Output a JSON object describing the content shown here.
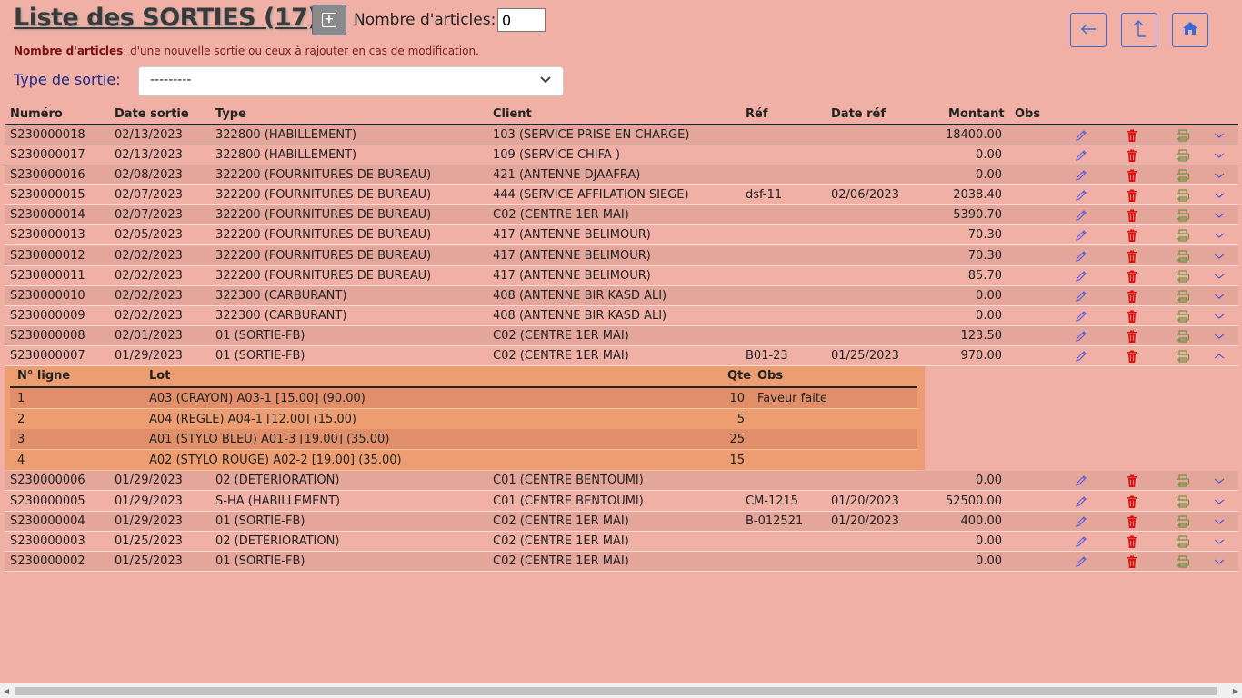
{
  "header": {
    "title": "Liste des SORTIES (17)",
    "add_icon_glyph": "+",
    "nb_articles_label": "Nombre d'articles:",
    "nb_articles_value": "0",
    "help_bold": "Nombre d'articles",
    "help_text": ": d'une nouvelle sortie ou ceux à rajouter en cas de modification.",
    "type_label": "Type de sortie:",
    "type_selected": "---------"
  },
  "nav": {
    "back_icon": "arrow-left-icon",
    "up_icon": "arrow-up-icon",
    "home_icon": "home-icon",
    "accent_color": "#3a6bd8"
  },
  "table": {
    "columns": {
      "numero": "Numéro",
      "date_sortie": "Date sortie",
      "type": "Type",
      "client": "Client",
      "ref": "Réf",
      "date_ref": "Date réf",
      "montant": "Montant",
      "obs": "Obs"
    },
    "rows": [
      {
        "numero": "S230000018",
        "date": "02/13/2023",
        "type": "322800 (HABILLEMENT)",
        "client": "103 (SERVICE PRISE EN CHARGE)",
        "ref": "",
        "date_ref": "",
        "montant": "18400.00"
      },
      {
        "numero": "S230000017",
        "date": "02/13/2023",
        "type": "322800 (HABILLEMENT)",
        "client": "109 (SERVICE CHIFA )",
        "ref": "",
        "date_ref": "",
        "montant": "0.00"
      },
      {
        "numero": "S230000016",
        "date": "02/08/2023",
        "type": "322200 (FOURNITURES DE BUREAU)",
        "client": "421 (ANTENNE DJAAFRA)",
        "ref": "",
        "date_ref": "",
        "montant": "0.00"
      },
      {
        "numero": "S230000015",
        "date": "02/07/2023",
        "type": "322200 (FOURNITURES DE BUREAU)",
        "client": "444 (SERVICE AFFILATION SIEGE)",
        "ref": "dsf-11",
        "date_ref": "02/06/2023",
        "montant": "2038.40"
      },
      {
        "numero": "S230000014",
        "date": "02/07/2023",
        "type": "322200 (FOURNITURES DE BUREAU)",
        "client": "C02 (CENTRE 1ER MAI)",
        "ref": "",
        "date_ref": "",
        "montant": "5390.70"
      },
      {
        "numero": "S230000013",
        "date": "02/05/2023",
        "type": "322200 (FOURNITURES DE BUREAU)",
        "client": "417 (ANTENNE BELIMOUR)",
        "ref": "",
        "date_ref": "",
        "montant": "70.30"
      },
      {
        "numero": "S230000012",
        "date": "02/02/2023",
        "type": "322200 (FOURNITURES DE BUREAU)",
        "client": "417 (ANTENNE BELIMOUR)",
        "ref": "",
        "date_ref": "",
        "montant": "70.30"
      },
      {
        "numero": "S230000011",
        "date": "02/02/2023",
        "type": "322200 (FOURNITURES DE BUREAU)",
        "client": "417 (ANTENNE BELIMOUR)",
        "ref": "",
        "date_ref": "",
        "montant": "85.70"
      },
      {
        "numero": "S230000010",
        "date": "02/02/2023",
        "type": "322300 (CARBURANT)",
        "client": "408 (ANTENNE BIR KASD ALI)",
        "ref": "",
        "date_ref": "",
        "montant": "0.00"
      },
      {
        "numero": "S230000009",
        "date": "02/02/2023",
        "type": "322300 (CARBURANT)",
        "client": "408 (ANTENNE BIR KASD ALI)",
        "ref": "",
        "date_ref": "",
        "montant": "0.00"
      },
      {
        "numero": "S230000008",
        "date": "02/01/2023",
        "type": "01 (SORTIE-FB)",
        "client": "C02 (CENTRE 1ER MAI)",
        "ref": "",
        "date_ref": "",
        "montant": "123.50"
      },
      {
        "numero": "S230000007",
        "date": "01/29/2023",
        "type": "01 (SORTIE-FB)",
        "client": "C02 (CENTRE 1ER MAI)",
        "ref": "B01-23",
        "date_ref": "01/25/2023",
        "montant": "970.00"
      },
      {
        "numero": "S230000006",
        "date": "01/29/2023",
        "type": "02 (DETERIORATION)",
        "client": "C01 (CENTRE BENTOUMI)",
        "ref": "",
        "date_ref": "",
        "montant": "0.00"
      },
      {
        "numero": "S230000005",
        "date": "01/29/2023",
        "type": "S-HA (HABILLEMENT)",
        "client": "C01 (CENTRE BENTOUMI)",
        "ref": "CM-1215",
        "date_ref": "01/20/2023",
        "montant": "52500.00"
      },
      {
        "numero": "S230000004",
        "date": "01/29/2023",
        "type": "01 (SORTIE-FB)",
        "client": "C02 (CENTRE 1ER MAI)",
        "ref": "B-012521",
        "date_ref": "01/20/2023",
        "montant": "400.00"
      },
      {
        "numero": "S230000003",
        "date": "01/25/2023",
        "type": "02 (DETERIORATION)",
        "client": "C02 (CENTRE 1ER MAI)",
        "ref": "",
        "date_ref": "",
        "montant": "0.00"
      },
      {
        "numero": "S230000002",
        "date": "01/25/2023",
        "type": "01 (SORTIE-FB)",
        "client": "C02 (CENTRE 1ER MAI)",
        "ref": "",
        "date_ref": "",
        "montant": "0.00"
      }
    ],
    "expanded_index": 11,
    "icons": {
      "edit": "pencil-icon",
      "delete": "trash-icon",
      "print": "printer-icon",
      "expand": "chevron-down-icon",
      "collapse": "chevron-up-icon"
    },
    "colors": {
      "edit": "#5a5ae0",
      "delete": "#e01010",
      "print": "#6a8a3a",
      "expand": "#4a4ad0"
    }
  },
  "detail": {
    "columns": {
      "ligne": "N° ligne",
      "lot": "Lot",
      "qte": "Qte",
      "obs": "Obs"
    },
    "rows": [
      {
        "ligne": "1",
        "lot": "A03 (CRAYON) A03-1 [15.00] (90.00)",
        "qte": "10",
        "obs": "Faveur faite"
      },
      {
        "ligne": "2",
        "lot": "A04 (REGLE) A04-1 [12.00] (15.00)",
        "qte": "5",
        "obs": ""
      },
      {
        "ligne": "3",
        "lot": "A01 (STYLO BLEU) A01-3 [19.00] (35.00)",
        "qte": "25",
        "obs": ""
      },
      {
        "ligne": "4",
        "lot": "A02 (STYLO ROUGE) A02-2 [19.00] (35.00)",
        "qte": "15",
        "obs": ""
      }
    ]
  }
}
